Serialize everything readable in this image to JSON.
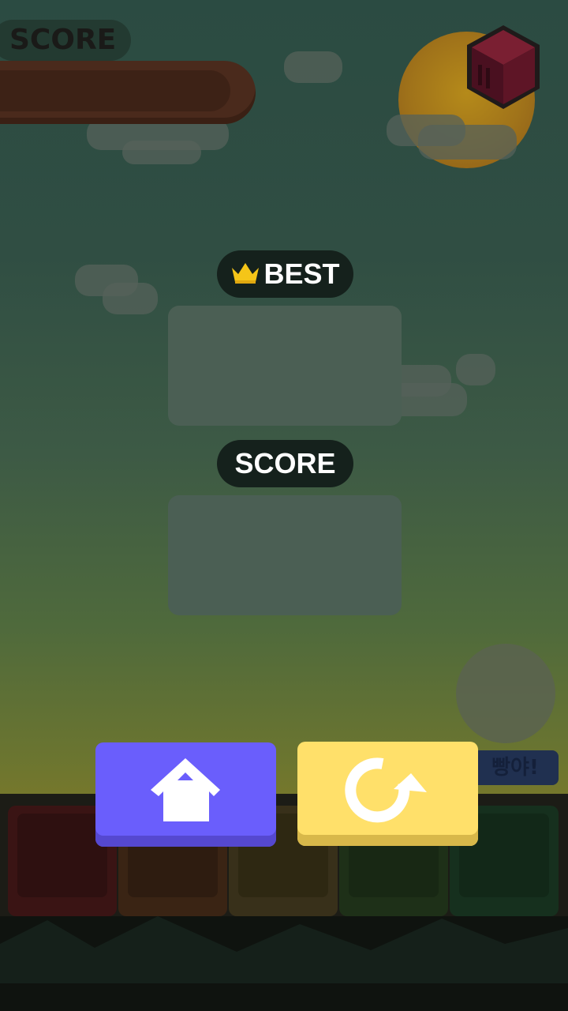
{
  "hud": {
    "score_label": "SCORE"
  },
  "results": {
    "best_label": "BEST",
    "best_value": "",
    "score_label": "SCORE",
    "score_value": ""
  },
  "speech_tag": "빵야!",
  "buttons": {
    "home_icon": "home-icon",
    "retry_icon": "retry-icon"
  },
  "colors": {
    "home_button": "#6a5efc",
    "retry_button": "#ffe06a",
    "pill_bg": "#15211c"
  }
}
